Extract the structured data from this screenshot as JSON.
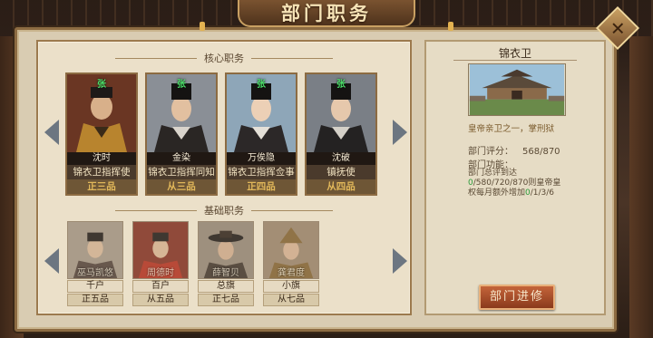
{
  "window": {
    "title": "部门职务",
    "close_icon": "close-icon"
  },
  "core_section": {
    "label": "核心职务",
    "officials": [
      {
        "surname": "张",
        "name": "沈时",
        "title": "锦衣卫指挥使",
        "rank": "正三品"
      },
      {
        "surname": "张",
        "name": "金染",
        "title": "锦衣卫指挥同知",
        "rank": "从三品"
      },
      {
        "surname": "张",
        "name": "万俟隐",
        "title": "锦衣卫指挥佥事",
        "rank": "正四品"
      },
      {
        "surname": "张",
        "name": "沈破",
        "title": "镇抚使",
        "rank": "从四品"
      }
    ]
  },
  "basic_section": {
    "label": "基础职务",
    "officials": [
      {
        "name": "巫马凯悠",
        "title": "千户",
        "rank": "正五品"
      },
      {
        "name": "周德时",
        "title": "百户",
        "rank": "从五品"
      },
      {
        "name": "薛智贝",
        "title": "总旗",
        "rank": "正七品"
      },
      {
        "name": "龚君度",
        "title": "小旗",
        "rank": "从七品"
      }
    ]
  },
  "department": {
    "name": "锦衣卫",
    "description": "皇帝亲卫之一，掌刑狱",
    "score_label": "部门评分：",
    "score_value": "568/870",
    "function_label": "部门功能：",
    "function_text_1": "部门总评到达",
    "function_val_1": "0",
    "function_text_2": "/580/720/870则皇帝皇权每月额外增加",
    "function_val_2": "0",
    "function_text_3": "/1/3/6",
    "upgrade_button": "部门进修"
  },
  "colors": {
    "accent_gold": "#e2b85a",
    "surname_green": "#4ce06a",
    "upgrade_red": "#a84a28"
  }
}
